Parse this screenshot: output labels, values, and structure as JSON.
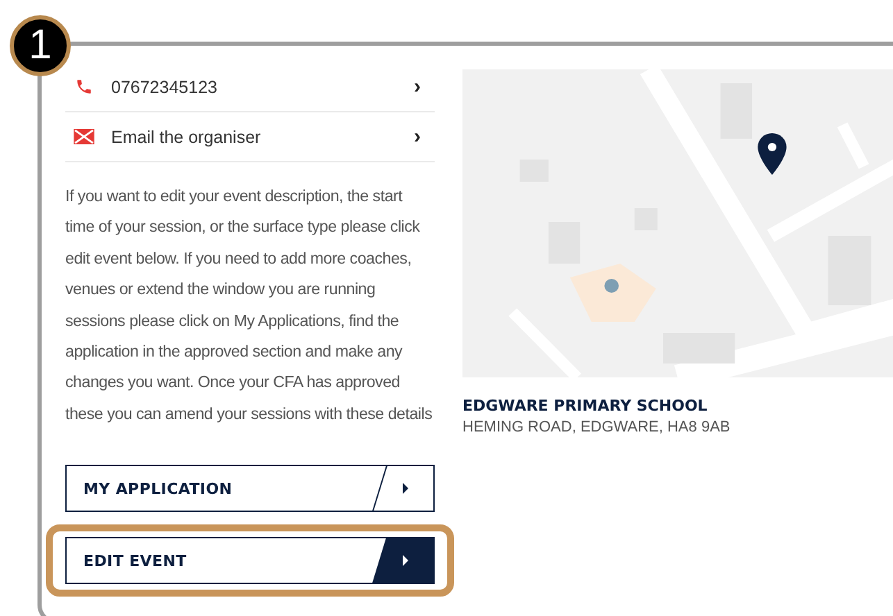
{
  "step_badge": "1",
  "contacts": [
    {
      "kind": "phone",
      "label": "07672345123",
      "chevron": "›"
    },
    {
      "kind": "email",
      "label": "Email the organiser",
      "chevron": "›"
    }
  ],
  "description": "If you want to edit your event description, the start time of your session, or the surface type please click edit event below. If you need to add more coaches, venues or extend the window you are running sessions please click on My Applications, find the application in the approved section and make any changes you want. Once your CFA has approved these you can amend your sessions with these details",
  "buttons": [
    {
      "label": "MY APPLICATION",
      "kind": "outline",
      "highlighted": false
    },
    {
      "label": "EDIT EVENT",
      "kind": "filled",
      "highlighted": true
    }
  ],
  "venue": {
    "name": "EDGWARE PRIMARY SCHOOL",
    "address": "HEMING ROAD, EDGWARE, HA8 9AB"
  }
}
